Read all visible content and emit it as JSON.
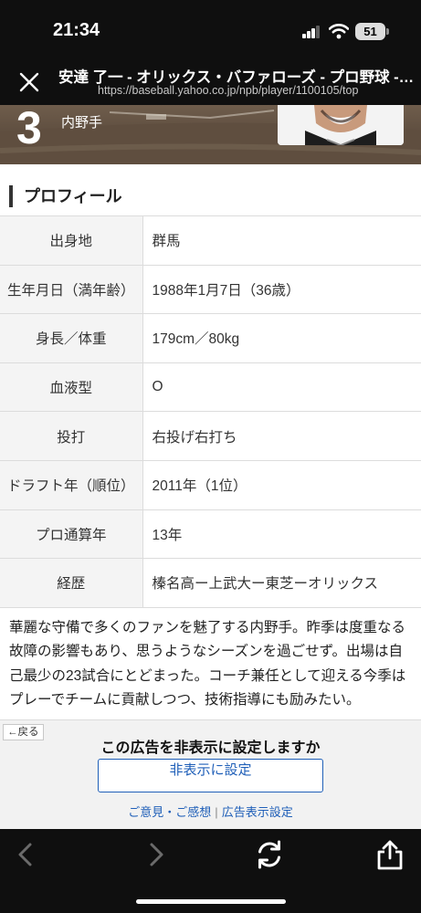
{
  "status_bar": {
    "time": "21:34",
    "battery": "51"
  },
  "browser": {
    "title": "安達 了一 - オリックス・バファローズ - プロ野球 - スポーツナビ",
    "url": "https://baseball.yahoo.co.jp/npb/player/1100105/top"
  },
  "player": {
    "number": "3",
    "position": "内野手"
  },
  "profile": {
    "heading": "プロフィール",
    "rows": [
      {
        "label": "出身地",
        "value": "群馬"
      },
      {
        "label": "生年月日（満年齢）",
        "value": "1988年1月7日（36歳）"
      },
      {
        "label": "身長／体重",
        "value": "179cm／80kg"
      },
      {
        "label": "血液型",
        "value": "O"
      },
      {
        "label": "投打",
        "value": "右投げ右打ち"
      },
      {
        "label": "ドラフト年（順位）",
        "value": "2011年（1位）"
      },
      {
        "label": "プロ通算年",
        "value": "13年"
      },
      {
        "label": "経歴",
        "value": "榛名高ー上武大ー東芝ーオリックス"
      }
    ],
    "description": "華麗な守備で多くのファンを魅了する内野手。昨季は度重なる故障の影響もあり、思うようなシーズンを過ごせず。出場は自己最少の23試合にとどまった。コーチ兼任として迎える今季はプレーでチームに貢献しつつ、技術指導にも励みたい。"
  },
  "ad": {
    "back_label": "戻る",
    "question": "この広告を非表示に設定しますか",
    "hide_button": "非表示に設定",
    "feedback_link": "ご意見・ご感想",
    "ad_settings_link": "広告表示設定"
  },
  "toolbar": {
    "icons": [
      "back-arrow-icon",
      "forward-arrow-icon",
      "reload-icon",
      "share-icon"
    ]
  }
}
